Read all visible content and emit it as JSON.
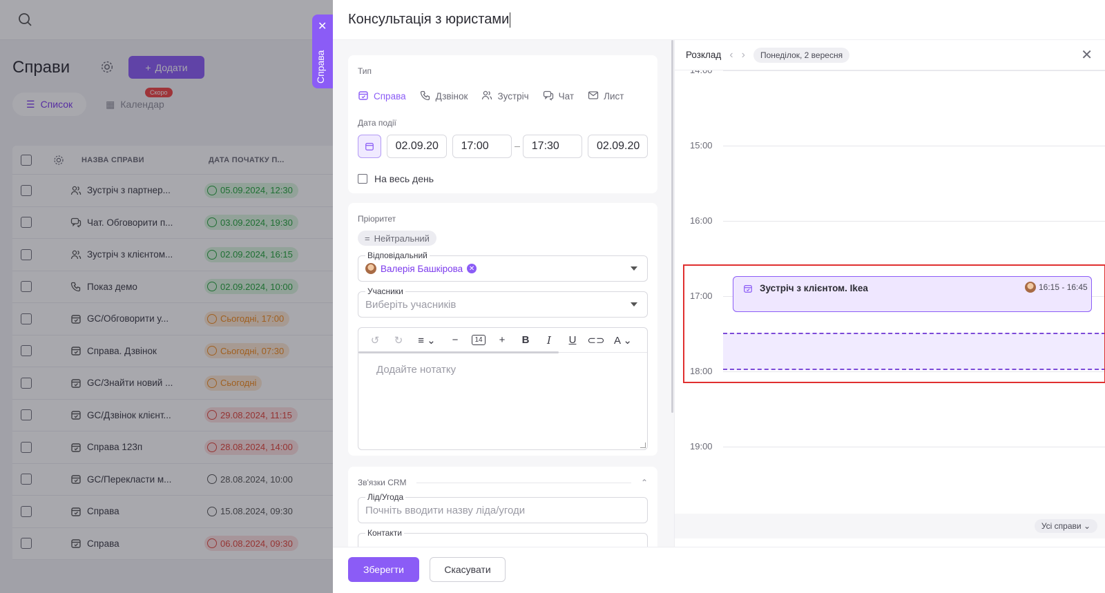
{
  "background": {
    "page_title": "Справи",
    "add_button": "Додати",
    "tabs": {
      "list": "Список",
      "calendar": "Календар",
      "soon_badge": "Скоро"
    },
    "columns": {
      "name": "НАЗВА СПРАВИ",
      "start_date": "ДАТА ПОЧАТКУ П..."
    },
    "rows": [
      {
        "name": "Зустріч з партнер...",
        "icon": "users-icon",
        "date": "05.09.2024, 12:30",
        "status": "green"
      },
      {
        "name": "Чат. Обговорити п...",
        "icon": "chat-icon",
        "date": "03.09.2024, 19:30",
        "status": "green"
      },
      {
        "name": "Зустріч з клієнтом...",
        "icon": "users-icon",
        "date": "02.09.2024, 16:15",
        "status": "green"
      },
      {
        "name": "Показ демо",
        "icon": "phone-icon",
        "date": "02.09.2024, 10:00",
        "status": "green"
      },
      {
        "name": "GC/Обговорити у...",
        "icon": "calendar-check-icon",
        "date": "Сьогодні, 17:00",
        "status": "orange"
      },
      {
        "name": "Справа. Дзвінок",
        "icon": "calendar-check-icon",
        "date": "Сьогодні, 07:30",
        "status": "orange"
      },
      {
        "name": "GC/Знайти новий ...",
        "icon": "calendar-check-icon",
        "date": "Сьогодні",
        "status": "orange"
      },
      {
        "name": "GC/Дзвінок клієнт...",
        "icon": "calendar-check-icon",
        "date": "29.08.2024, 11:15",
        "status": "red"
      },
      {
        "name": "Справа 123п",
        "icon": "calendar-check-icon",
        "date": "28.08.2024, 14:00",
        "status": "red"
      },
      {
        "name": "GC/Перекласти м...",
        "icon": "calendar-check-icon",
        "date": "28.08.2024, 10:00",
        "status": "none"
      },
      {
        "name": "Справа",
        "icon": "calendar-check-icon",
        "date": "15.08.2024, 09:30",
        "status": "none"
      },
      {
        "name": "Справа",
        "icon": "calendar-check-icon",
        "date": "06.08.2024, 09:30",
        "status": "red"
      }
    ]
  },
  "side_tab": {
    "label": "Справа"
  },
  "drawer": {
    "title": "Консультація з юристами",
    "type": {
      "label": "Тип",
      "options": [
        {
          "label": "Справа",
          "icon": "calendar-check-icon",
          "active": true
        },
        {
          "label": "Дзвінок",
          "icon": "phone-icon",
          "active": false
        },
        {
          "label": "Зустріч",
          "icon": "users-icon",
          "active": false
        },
        {
          "label": "Чат",
          "icon": "chat-icon",
          "active": false
        },
        {
          "label": "Лист",
          "icon": "mail-icon",
          "active": false
        }
      ]
    },
    "event_date": {
      "label": "Дата події",
      "start_date": "02.09.20",
      "start_time": "17:00",
      "end_time": "17:30",
      "end_date": "02.09.20",
      "all_day": "На весь день"
    },
    "priority": {
      "label": "Пріоритет",
      "value": "Нейтральний"
    },
    "responsible": {
      "label": "Відповідальний",
      "value": "Валерія Башкірова"
    },
    "participants": {
      "label": "Учасники",
      "placeholder": "Виберіть учасників"
    },
    "editor": {
      "font_size": "14",
      "placeholder": "Додайте нотатку"
    },
    "crm": {
      "label": "Зв'язки CRM",
      "lead": {
        "label": "Лід/Угода",
        "placeholder": "Почніть вводити назву ліда/угоди"
      },
      "contacts": {
        "label": "Контакти"
      }
    },
    "save": "Зберегти",
    "cancel": "Скасувати"
  },
  "schedule": {
    "title": "Розклад",
    "day": "Понеділок, 2 вересня",
    "hours": [
      "14:00",
      "15:00",
      "16:00",
      "17:00",
      "18:00",
      "19:00"
    ],
    "event": {
      "title": "Зустріч з клієнтом. Ikea",
      "time": "16:15 - 16:45"
    },
    "filter": "Усі справи"
  },
  "colors": {
    "accent": "#8b5cf6",
    "highlight": "#e02f2f"
  }
}
